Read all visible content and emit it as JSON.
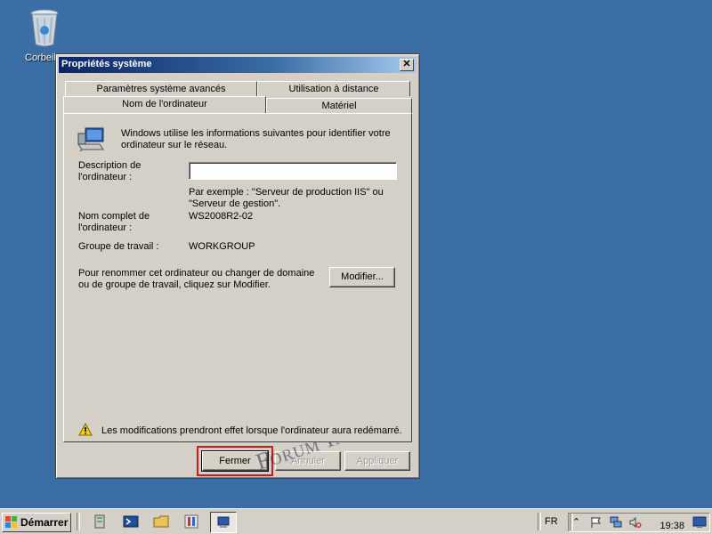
{
  "desktop": {
    "recycle_bin_label": "Corbeil"
  },
  "dialog": {
    "title": "Propriétés système",
    "close_glyph": "✕",
    "tabs": [
      {
        "label": "Paramètres système avancés"
      },
      {
        "label": "Utilisation à distance"
      },
      {
        "label": "Nom de l'ordinateur"
      },
      {
        "label": "Matériel"
      }
    ],
    "intro": "Windows utilise les informations suivantes pour identifier votre ordinateur sur le réseau.",
    "description_label": "Description de\nl'ordinateur :",
    "description_value": "",
    "example": "Par exemple : \"Serveur de production IIS\" ou\n\"Serveur de gestion\".",
    "full_name_label": "Nom complet de\nl'ordinateur :",
    "full_name_value": "WS2008R2-02",
    "workgroup_label": "Groupe de travail :",
    "workgroup_value": "WORKGROUP",
    "rename_text": "Pour renommer cet ordinateur ou changer de domaine\nou de groupe de travail, cliquez sur Modifier.",
    "modify_button": "Modifier...",
    "warning_text": "Les modifications prendront effet lorsque l'ordinateur aura redémarré.",
    "close_button": "Fermer",
    "cancel_button": "Annuler",
    "apply_button": "Appliquer"
  },
  "watermark": "Forum InfoPC",
  "taskbar": {
    "start_label": "Démarrer",
    "language": "FR",
    "clock": "19:38"
  },
  "colors": {
    "desktop": "#3a6ea5",
    "highlight": "#d11a1a"
  }
}
